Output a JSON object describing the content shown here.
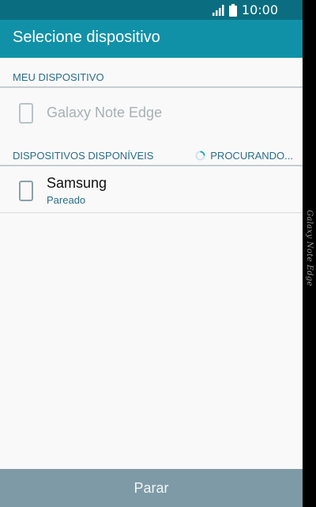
{
  "statusbar": {
    "time": "10:00",
    "signal_icon": "signal-icon",
    "battery_icon": "battery-icon"
  },
  "appbar": {
    "title": "Selecione dispositivo"
  },
  "my_device": {
    "header": "MEU DISPOSITIVO",
    "device_name": "Galaxy Note Edge",
    "icon": "phone-icon"
  },
  "available": {
    "header": "DISPOSITIVOS DISPONÍVEIS",
    "scanning_label": "PROCURANDO...",
    "devices": [
      {
        "name": "Samsung",
        "status": "Pareado",
        "icon": "phone-icon"
      }
    ]
  },
  "footer": {
    "stop_label": "Parar"
  },
  "edge_panel": {
    "label": "Galaxy Note Edge"
  },
  "colors": {
    "statusbar": "#0a6e80",
    "appbar": "#1191a7",
    "accent_text": "#2b6d88",
    "footer": "#7d9aa6"
  }
}
